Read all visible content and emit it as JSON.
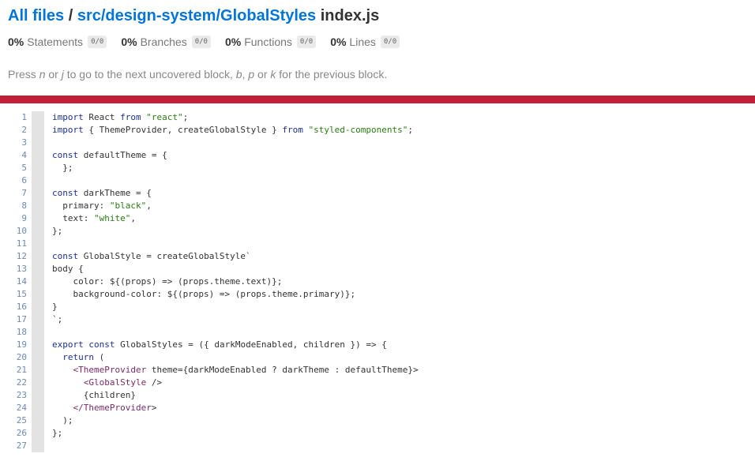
{
  "breadcrumb": {
    "root": "All files",
    "separator": "/",
    "dir": "src/design-system/GlobalStyles",
    "file": "index.js"
  },
  "summary": [
    {
      "pct": "0%",
      "label": "Statements",
      "fraction": "0/0"
    },
    {
      "pct": "0%",
      "label": "Branches",
      "fraction": "0/0"
    },
    {
      "pct": "0%",
      "label": "Functions",
      "fraction": "0/0"
    },
    {
      "pct": "0%",
      "label": "Lines",
      "fraction": "0/0"
    }
  ],
  "hint": {
    "p1": "Press ",
    "k1": "n",
    "p2": " or ",
    "k2": "j",
    "p3": " to go to the next uncovered block, ",
    "k3": "b",
    "p4": ", ",
    "k4": "p",
    "p5": " or ",
    "k5": "k",
    "p6": " for the previous block."
  },
  "colors": {
    "status_bar": "#C21F39",
    "link": "#0074D9"
  },
  "code": {
    "line_numbers": [
      "1",
      "2",
      "3",
      "4",
      "5",
      "6",
      "7",
      "8",
      "9",
      "10",
      "11",
      "12",
      "13",
      "14",
      "15",
      "16",
      "17",
      "18",
      "19",
      "20",
      "21",
      "22",
      "23",
      "24",
      "25",
      "26",
      "27"
    ],
    "lines": [
      "import React from \"react\";",
      "import { ThemeProvider, createGlobalStyle } from \"styled-components\";",
      "",
      "const defaultTheme = {",
      "  };",
      "",
      "const darkTheme = {",
      "  primary: \"black\",",
      "  text: \"white\",",
      "};",
      "",
      "const GlobalStyle = createGlobalStyle`",
      "body {",
      "    color: ${(props) => (props.theme.text)};",
      "    background-color: ${(props) => (props.theme.primary)};",
      "}",
      "`;",
      "",
      "export const GlobalStyles = ({ darkModeEnabled, children }) => {",
      "  return (",
      "    <ThemeProvider theme={darkModeEnabled ? darkTheme : defaultTheme}>",
      "      <GlobalStyle />",
      "      {children}",
      "    </ThemeProvider>",
      "  );",
      "};",
      ""
    ]
  }
}
